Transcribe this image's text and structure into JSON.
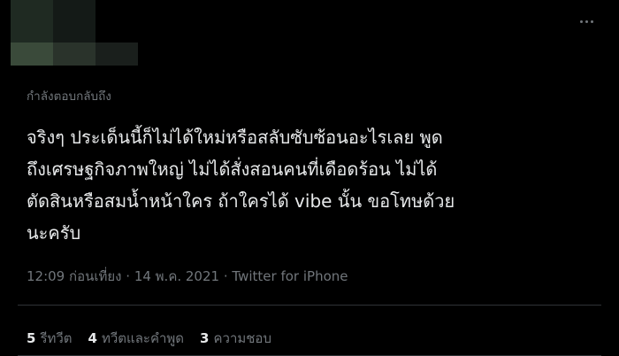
{
  "colors": {
    "background": "#000000",
    "text_primary": "#e7e9ea",
    "text_secondary": "#71767b",
    "divider": "#2f3336"
  },
  "header": {
    "more_icon": "more-horizontal-icon"
  },
  "tweet": {
    "replying_to": "กำลังตอบกลับถึง",
    "text_lines": [
      "จริงๆ ประเด็นนี้ก็ไม่ได้ใหม่หรือสลับซับซ้อนอะไรเลย พูด",
      "ถึงเศรษฐกิจภาพใหญ่ ไม่ได้สั่งสอนคนที่เดือดร้อน ไม่ได้",
      "ตัดสินหรือสมน้ำหน้าใคร ถ้าใครได้ vibe นั้น ขอโทษด้วย",
      "นะครับ"
    ],
    "time": "12:09 ก่อนเที่ยง",
    "separator": "·",
    "date": "14 พ.ค. 2021",
    "source": "Twitter for iPhone"
  },
  "stats": {
    "retweets": {
      "count": "5",
      "label": "รีทวีต"
    },
    "quotes": {
      "count": "4",
      "label": "ทวีตและคำพูด"
    },
    "likes": {
      "count": "3",
      "label": "ความชอบ"
    }
  }
}
